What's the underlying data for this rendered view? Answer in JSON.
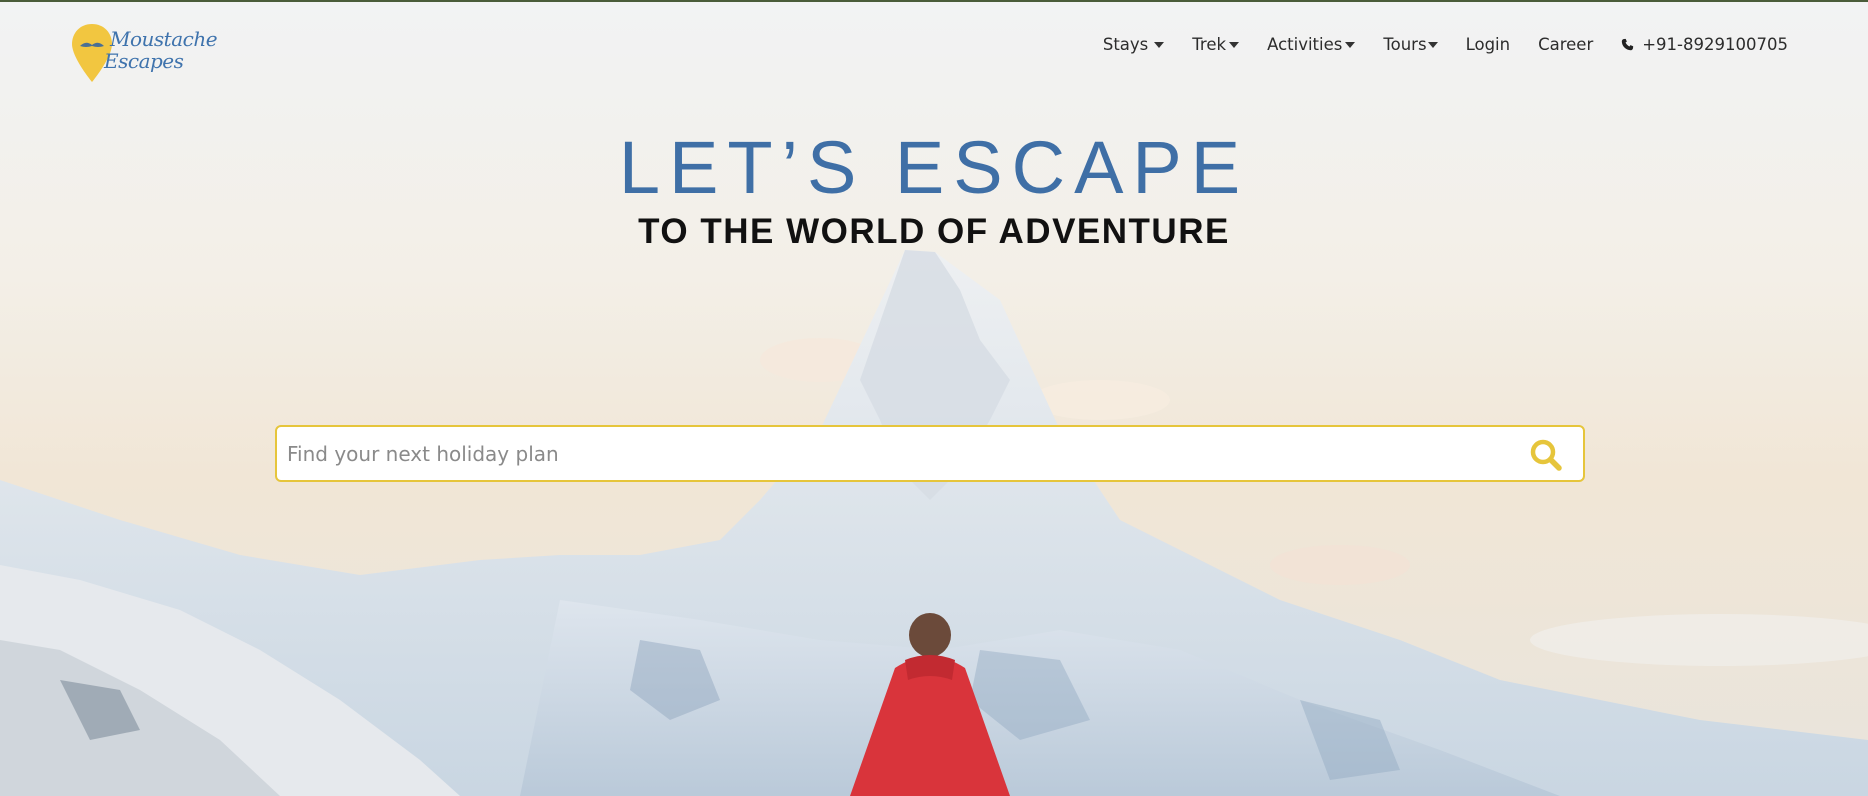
{
  "brand": {
    "name_line1": "Moustache",
    "name_line2": "Escapes",
    "accent": "#3f73ad",
    "pin_color": "#f2c640"
  },
  "nav": {
    "items": [
      {
        "label": "Stays",
        "dropdown": true
      },
      {
        "label": "Trek",
        "dropdown": true
      },
      {
        "label": "Activities",
        "dropdown": true
      },
      {
        "label": "Tours",
        "dropdown": true
      },
      {
        "label": "Login",
        "dropdown": false
      },
      {
        "label": "Career",
        "dropdown": false
      }
    ],
    "phone": "+91-8929100705",
    "phone_icon": "phone-icon"
  },
  "hero": {
    "headline": "LET’S ESCAPE",
    "subheadline": "TO THE WORLD OF ADVENTURE",
    "headline_color": "#3f6fa6"
  },
  "search": {
    "placeholder": "Find your next holiday plan",
    "value": "",
    "border_color": "#e6c53b",
    "icon": "search-icon"
  }
}
